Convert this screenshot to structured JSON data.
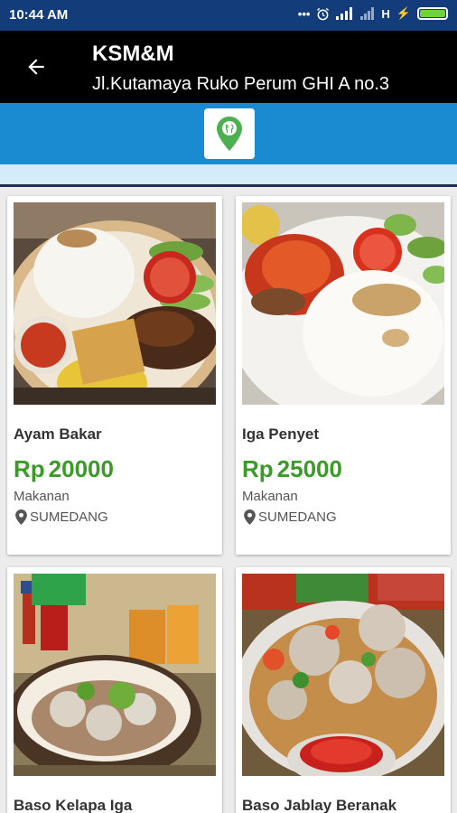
{
  "status": {
    "time": "10:44 AM",
    "network": "H"
  },
  "header": {
    "title": "KSM&M",
    "subtitle": "Jl.Kutamaya Ruko Perum GHI A no.3"
  },
  "products": [
    {
      "name": "Ayam Bakar",
      "currency": "Rp",
      "price": "20000",
      "category": "Makanan",
      "location": "SUMEDANG"
    },
    {
      "name": "Iga Penyet",
      "currency": "Rp",
      "price": "25000",
      "category": "Makanan",
      "location": "SUMEDANG"
    },
    {
      "name": "Baso Kelapa Iga"
    },
    {
      "name": "Baso Jablay Beranak"
    }
  ],
  "colors": {
    "statusbar": "#123c7a",
    "appbar": "#000000",
    "accent_bar": "#1a8bd1",
    "price": "#3a9b27",
    "map_marker": "#4caf50"
  },
  "icons": {
    "back": "arrow-left-icon",
    "map": "map-marker-icon",
    "location": "location-pin-icon"
  }
}
